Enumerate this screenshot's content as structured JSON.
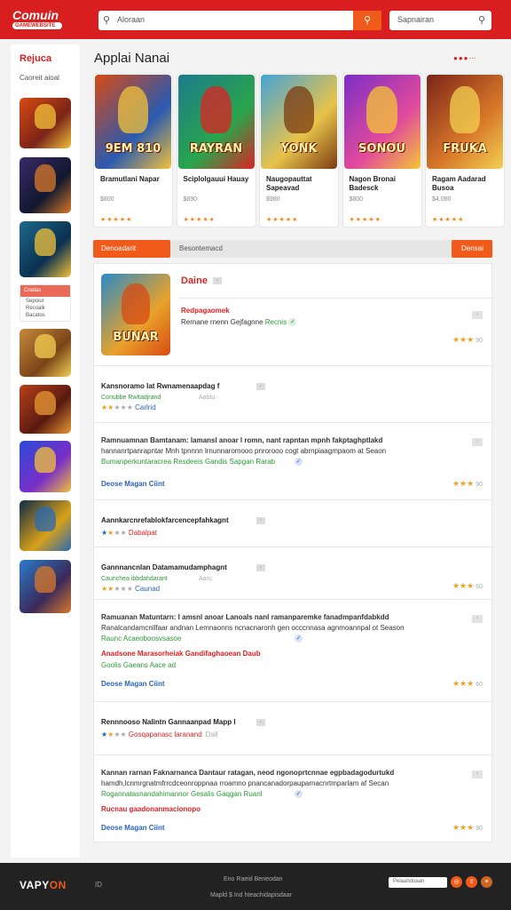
{
  "header": {
    "logo": "Comuin",
    "logo_sub": "GAMEWEBSITE",
    "search_placeholder": "Aloraan",
    "search2_placeholder": "Sapnairan"
  },
  "sidebar": {
    "title": "Rejuca",
    "subtitle": "Caoreit aioal",
    "card_title": "Cradas",
    "card_lines": [
      "Sepoiur",
      "Recoalk",
      "Bacatos"
    ]
  },
  "main": {
    "heading": "Applai Nanai",
    "heading_dots": "●●●⋯",
    "featured": [
      {
        "title": "Bramutlani Napar",
        "price": "$800",
        "stars": "★★★★★",
        "art_text": "9EM 810",
        "palette": [
          "#d84a12",
          "#2a5ab0",
          "#f2c23a"
        ]
      },
      {
        "title": "Sciplolgauui Hauay",
        "price": "$890",
        "stars": "★★★★★",
        "art_text": "RAYRAN",
        "palette": [
          "#1e7a8c",
          "#29a54c",
          "#d22"
        ]
      },
      {
        "title": "Naugopauttat Sapeavad",
        "price": "$980",
        "stars": "★★★★★",
        "art_text": "YONK",
        "palette": [
          "#43a3d8",
          "#e7c34a",
          "#7b3b12"
        ]
      },
      {
        "title": "Nagon Bronai Badesck",
        "price": "$800",
        "stars": "★★★★★",
        "art_text": "SONOU",
        "palette": [
          "#7a2ec6",
          "#e24a9c",
          "#f4c634"
        ]
      },
      {
        "title": "Ragam Aadarad Busoa",
        "price": "$4.080",
        "stars": "★★★★★",
        "art_text": "FRUKA",
        "palette": [
          "#7b2418",
          "#d8782a",
          "#f3d052"
        ]
      }
    ],
    "tabs": {
      "active": "Denoadarit",
      "middle": "Besontemacd",
      "right": "Densai"
    },
    "detail": {
      "name": "Daine",
      "category": "Redpagaomek",
      "description": "Rernane rnenn Gejfagnne",
      "verified": "Recnis",
      "rating_label": "90",
      "art_text": "BUNAR"
    },
    "listing": [
      {
        "type": "short",
        "title": "Kansnoramo lat Rwnamenaapdag f",
        "sub": "Conubbe Rwltadjrand",
        "sub2": "Aabtu",
        "stars_label": "Carlrid"
      },
      {
        "type": "long",
        "line1": "Ramnuamnan Bamtanam: lamansl anoar l romn, nant  rapntan mpnh fakptaghptlakd",
        "line2": "hannanrtpanrapntar Mnh tpnnnn lrnunnaromooo pnrorooo cogt abrnpiaagmpaom at Seaon",
        "line3": "Bumanperkuntaracrea Resdeeis Gandis Sapgan Rarab",
        "link": "Deose Magan Ciint",
        "rating": "90"
      },
      {
        "type": "short2",
        "title": "Aannkarcnrefablokfarcencepfahkagnt",
        "sub": "Dabalpat"
      },
      {
        "type": "short",
        "title": "Gannnancnlan Datamamudamphagnt",
        "sub": "Caunchea ibbdahdarant",
        "sub2": "Aaru",
        "stars_label": "Caunad",
        "rating": "60"
      },
      {
        "type": "long",
        "line1": "Ramuanan Matuntarn: I amsnl anoar Lanoals  nanl ramanparemke fanadmpanfdabkdd",
        "line2": "Ranalcandamcnilfaar andnan Lemnaonns ncnacnaronh gen occcnnasa agnmoannpal ot Season",
        "line3": "Raunc Acaeoboosvsasoe",
        "line4": "Anadsone Marasorheiak Gandifaghaoean Daub",
        "line5": "Goolis Gaeans Aace ad",
        "link": "Deose Magan Ciint",
        "rating": "60"
      },
      {
        "type": "short2",
        "title": "Rennnooso Nalintn Gannaanpad Mapp l",
        "sub": "Gosqapanasc laranand",
        "sub2": "Dall"
      },
      {
        "type": "long",
        "line1": "Kannan rarnan Faknarnanca Dantaur ratagan, neod  ngonoprtcnnae egpbadagodurtukd",
        "line2": "hamdh,lcnmrgnatmfrrcdceonroppnaa  rroamno pnancanadorpauparnacnrtmparlam af Secan",
        "line3": "Rogannatasnandahimannor Gesalis Gaqgan Ruanl",
        "line4": "Rucnau gaadonanmacionopo",
        "link": "Deose Magan Ciint",
        "rating": "90"
      }
    ]
  },
  "footer": {
    "logo_a": "VAPY",
    "logo_b": "ON",
    "small": "ID",
    "line1": "Eno Raeid Beneodan",
    "line2": "Mapld $ Ind hteachidapisdaar",
    "search": "Pelaahdoaan"
  }
}
